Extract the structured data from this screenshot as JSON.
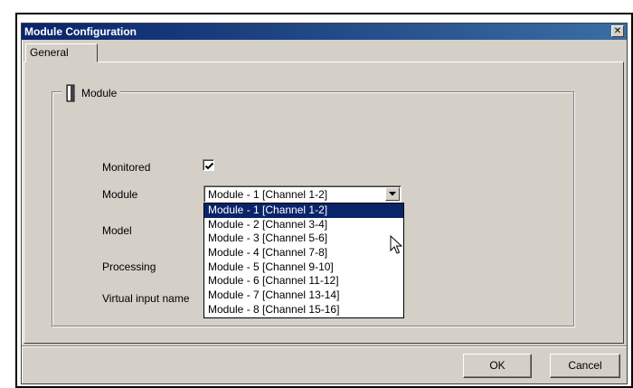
{
  "window": {
    "title": "Module Configuration",
    "close_glyph": "✕"
  },
  "tabs": [
    {
      "label": "General"
    }
  ],
  "groupbox": {
    "title": "Module",
    "icon": "module-icon"
  },
  "fields": {
    "monitored_label": "Monitored",
    "monitored_checked": true,
    "module_label": "Module",
    "module_value": "Module - 1 [Channel 1-2]",
    "model_label": "Model",
    "processing_label": "Processing",
    "virtual_input_label": "Virtual input name"
  },
  "dropdown": {
    "options": [
      "Module - 1 [Channel 1-2]",
      "Module - 2 [Channel 3-4]",
      "Module - 3 [Channel 5-6]",
      "Module - 4 [Channel 7-8]",
      "Module - 5 [Channel 9-10]",
      "Module - 6 [Channel 11-12]",
      "Module - 7 [Channel 13-14]",
      "Module - 8 [Channel 15-16]"
    ],
    "selected_index": 0
  },
  "buttons": {
    "ok": "OK",
    "cancel": "Cancel"
  },
  "colors": {
    "titlebar": "#0a246a",
    "selection": "#0a246a",
    "face": "#d4d0c8"
  }
}
